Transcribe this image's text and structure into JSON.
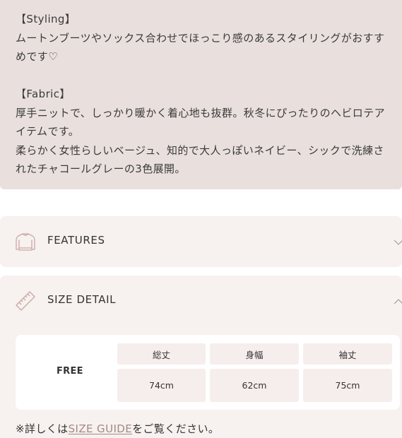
{
  "description": {
    "styling_heading": "【Styling】",
    "styling_text": "ムートンブーツやソックス合わせでほっこり感のあるスタイリングがおすすめです♡",
    "fabric_heading": "【Fabric】",
    "fabric_text_1": "厚手ニットで、しっかり暖かく着心地も抜群。秋冬にぴったりのヘビロテアイテムです。",
    "fabric_text_2": "柔らかく女性らしいベージュ、知的で大人っぽいネイビー、シックで洗練されたチャコールグレーの3色展開。"
  },
  "accordions": {
    "features": {
      "title": "FEATURES",
      "icon": "sweater-icon",
      "state": "collapsed"
    },
    "size_detail": {
      "title": "SIZE DETAIL",
      "icon": "ruler-icon",
      "state": "expanded"
    }
  },
  "size_table": {
    "row_label": "FREE",
    "headers": [
      "総丈",
      "身幅",
      "袖丈"
    ],
    "values": [
      "74cm",
      "62cm",
      "75cm"
    ]
  },
  "note": {
    "prefix": "※詳しくは",
    "link": "SIZE GUIDE",
    "suffix": "をご覧ください。"
  },
  "colors": {
    "description_bg": "#e9e0dd",
    "accordion_bg": "#f7f1ef",
    "cell_bg": "#f6eeec",
    "link": "#a38a84",
    "icon_stroke": "#c9a9a4"
  }
}
